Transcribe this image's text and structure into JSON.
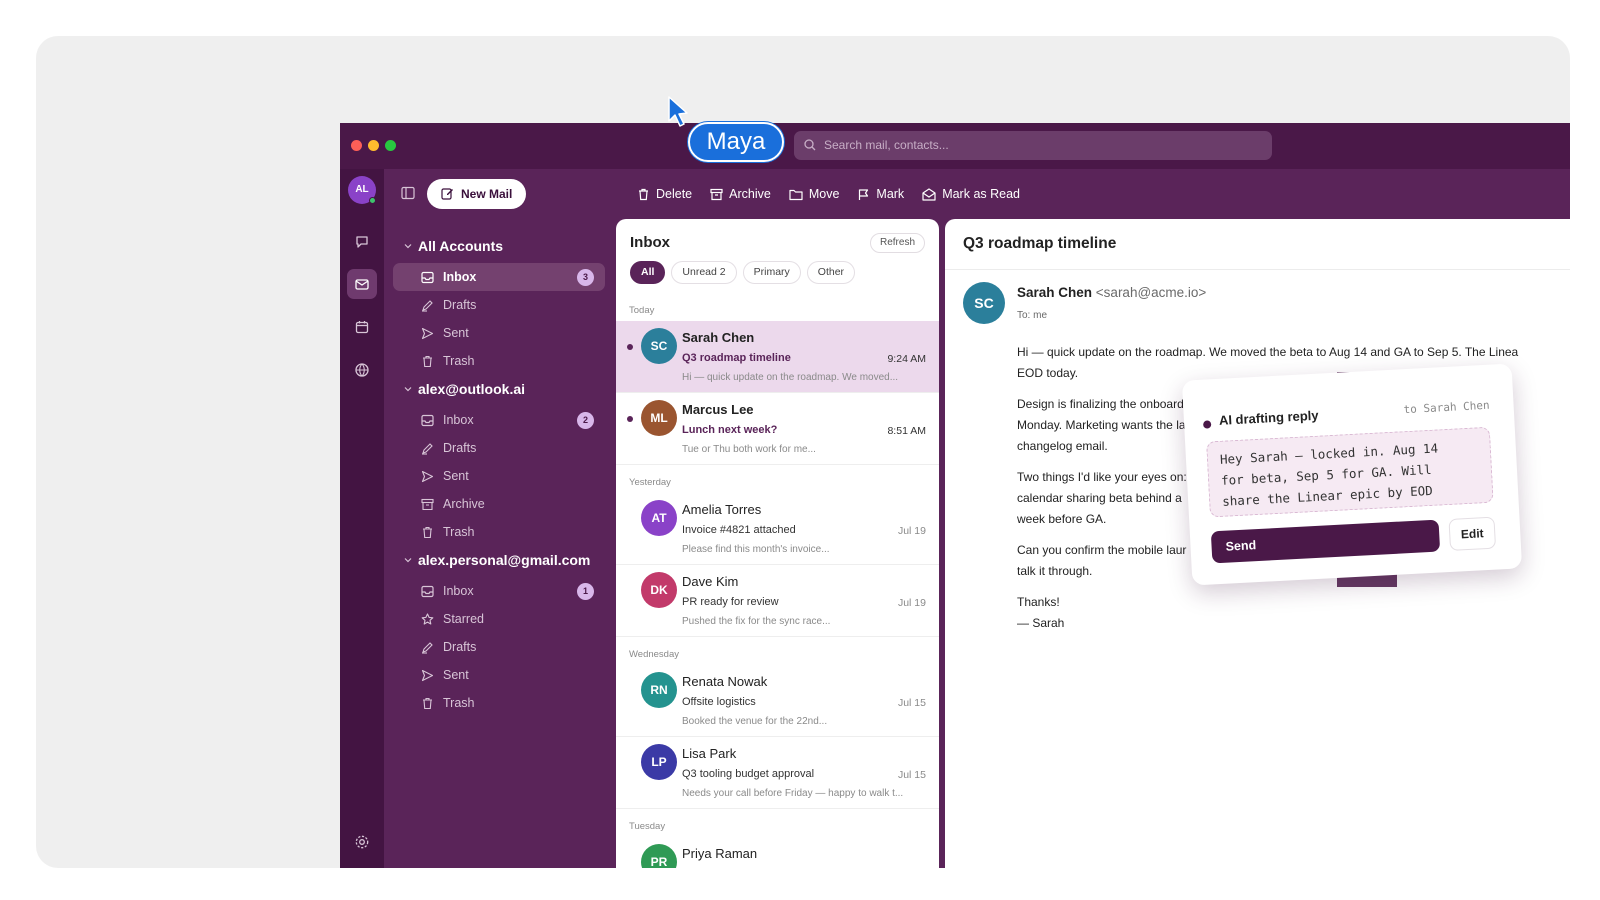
{
  "search": {
    "placeholder": "Search mail, contacts..."
  },
  "rail": {
    "avatar_initials": "AL"
  },
  "sidebar": {
    "new_mail_label": "New Mail",
    "accounts": [
      {
        "name": "All Accounts",
        "folders": [
          {
            "label": "Inbox",
            "icon": "inbox-icon",
            "badge": "3",
            "active": true
          },
          {
            "label": "Drafts",
            "icon": "pen-icon"
          },
          {
            "label": "Sent",
            "icon": "send-icon"
          },
          {
            "label": "Trash",
            "icon": "trash-icon"
          }
        ]
      },
      {
        "name": "alex@outlook.ai",
        "folders": [
          {
            "label": "Inbox",
            "icon": "inbox-icon",
            "badge": "2"
          },
          {
            "label": "Drafts",
            "icon": "pen-icon"
          },
          {
            "label": "Sent",
            "icon": "send-icon"
          },
          {
            "label": "Archive",
            "icon": "archive-icon"
          },
          {
            "label": "Trash",
            "icon": "trash-icon"
          }
        ]
      },
      {
        "name": "alex.personal@gmail.com",
        "folders": [
          {
            "label": "Inbox",
            "icon": "inbox-icon",
            "badge": "1"
          },
          {
            "label": "Starred",
            "icon": "star-icon"
          },
          {
            "label": "Drafts",
            "icon": "pen-icon"
          },
          {
            "label": "Sent",
            "icon": "send-icon"
          },
          {
            "label": "Trash",
            "icon": "trash-icon"
          }
        ]
      }
    ]
  },
  "toolbar": {
    "delete_label": "Delete",
    "archive_label": "Archive",
    "move_label": "Move",
    "mark_label": "Mark",
    "mark_read_label": "Mark as Read"
  },
  "list": {
    "title": "Inbox",
    "refresh_label": "Refresh",
    "chips": [
      "All",
      "Unread 2",
      "Primary",
      "Other"
    ],
    "sections": {
      "today": "Today",
      "yesterday": "Yesterday",
      "wednesday": "Wednesday",
      "tuesday": "Tuesday"
    },
    "messages": [
      {
        "initials": "SC",
        "color": "#2b7f9b",
        "name": "Sarah Chen",
        "subject": "Q3 roadmap timeline",
        "time": "9:24 AM",
        "preview": "Hi — quick update on the roadmap. We moved...",
        "unread": true,
        "selected": true
      },
      {
        "initials": "ML",
        "color": "#9a5530",
        "name": "Marcus Lee",
        "subject": "Lunch next week?",
        "time": "8:51 AM",
        "preview": "Tue or Thu both work for me...",
        "unread": true
      },
      {
        "initials": "AT",
        "color": "#8a42c8",
        "name": "Amelia Torres",
        "subject": "Invoice #4821 attached",
        "time": "Jul 19",
        "preview": "Please find this month's invoice..."
      },
      {
        "initials": "DK",
        "color": "#c23a6a",
        "name": "Dave Kim",
        "subject": "PR ready for review",
        "time": "Jul 19",
        "preview": "Pushed the fix for the sync race..."
      },
      {
        "initials": "RN",
        "color": "#24938f",
        "name": "Renata Nowak",
        "subject": "Offsite logistics",
        "time": "Jul 15",
        "preview": "Booked the venue for the 22nd..."
      },
      {
        "initials": "LP",
        "color": "#3b3aa6",
        "name": "Lisa Park",
        "subject": "Q3 tooling budget approval",
        "time": "Jul 15",
        "preview": "Needs your call before Friday — happy to walk t..."
      },
      {
        "initials": "PR",
        "color": "#2f9a55",
        "name": "Priya Raman",
        "subject": "",
        "time": "",
        "preview": ""
      }
    ]
  },
  "reader": {
    "subject": "Q3 roadmap timeline",
    "sender_initials": "SC",
    "sender_name": "Sarah Chen",
    "sender_email": "<sarah@acme.io>",
    "to": "To: me",
    "paragraphs": [
      "Hi — quick update on the roadmap. We moved the beta to Aug 14 and GA to Sep 5. The Linea",
      "EOD today.",
      "Design is finalizing the onboard",
      "Monday. Marketing wants the la",
      "changelog email.",
      "Two things I'd like your eyes on:",
      "calendar sharing beta behind a",
      "week before GA.",
      "Can you confirm the mobile laur",
      "talk it through.",
      "Thanks!",
      "— Sarah"
    ]
  },
  "ai_panel": {
    "title": "AI drafting reply",
    "to": "to Sarah Chen",
    "draft": "Hey Sarah — locked in. Aug 14\nfor beta, Sep 5 for GA. Will\nshare the Linear epic by EOD",
    "send_label": "Send",
    "edit_label": "Edit"
  },
  "cursor_label": "Maya"
}
